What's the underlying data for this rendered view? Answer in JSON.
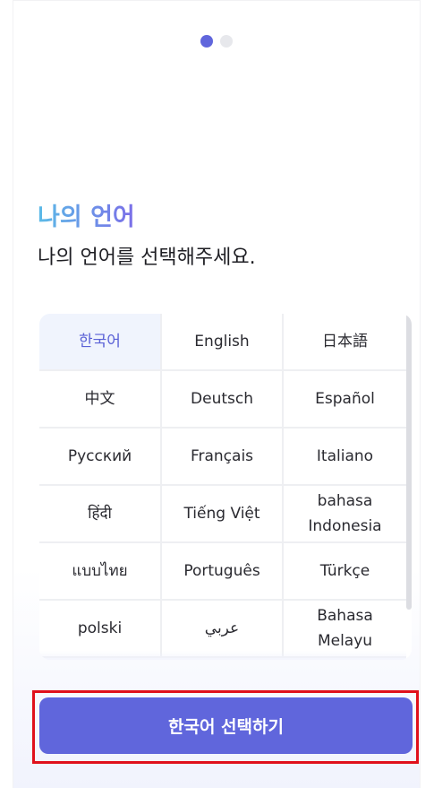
{
  "pager": {
    "total": 2,
    "current": 1
  },
  "header": {
    "title": "나의 언어",
    "subtitle": "나의 언어를 선택해주세요."
  },
  "languages": [
    "한국어",
    "English",
    "日本語",
    "中文",
    "Deutsch",
    "Español",
    "Русский",
    "Français",
    "Italiano",
    "हिंदी",
    "Tiếng Việt",
    "bahasa Indonesia",
    "แบบไทย",
    "Português",
    "Türkçe",
    "polski",
    "عربي",
    "Bahasa Melayu"
  ],
  "selected_language": "한국어",
  "footer": {
    "button_label": "한국어 선택하기"
  },
  "colors": {
    "accent": "#6066dc",
    "highlight": "#e0101b",
    "selected_bg": "#f0f4fd"
  }
}
